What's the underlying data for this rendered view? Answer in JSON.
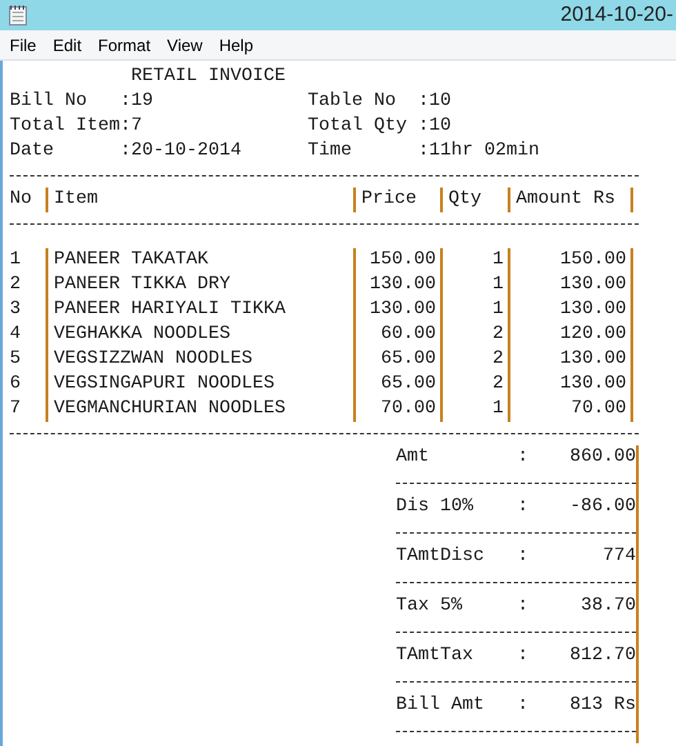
{
  "window": {
    "title": "2014-10-20-"
  },
  "menu": [
    "File",
    "Edit",
    "Format",
    "View",
    "Help"
  ],
  "invoice": {
    "heading": "RETAIL INVOICE",
    "fields": [
      [
        "Bill No   :19",
        "Table No  :10"
      ],
      [
        "Total Item:7",
        "Total Qty :10"
      ],
      [
        "Date      :20-10-2014",
        "Time      :11hr 02min"
      ]
    ],
    "columns": [
      "No",
      "Item",
      "Price",
      "Qty",
      "Amount Rs"
    ],
    "rows": [
      {
        "no": "1",
        "item": "PANEER TAKATAK",
        "price": "150.00",
        "qty": "1",
        "amount": "150.00"
      },
      {
        "no": "2",
        "item": "PANEER TIKKA DRY",
        "price": "130.00",
        "qty": "1",
        "amount": "130.00"
      },
      {
        "no": "3",
        "item": "PANEER HARIYALI TIKKA",
        "price": "130.00",
        "qty": "1",
        "amount": "130.00"
      },
      {
        "no": "4",
        "item": "VEGHAKKA NOODLES",
        "price": "60.00",
        "qty": "2",
        "amount": "120.00"
      },
      {
        "no": "5",
        "item": "VEGSIZZWAN NOODLES",
        "price": "65.00",
        "qty": "2",
        "amount": "130.00"
      },
      {
        "no": "6",
        "item": "VEGSINGAPURI NOODLES",
        "price": "65.00",
        "qty": "2",
        "amount": "130.00"
      },
      {
        "no": "7",
        "item": "VEGMANCHURIAN NOODLES",
        "price": "70.00",
        "qty": "1",
        "amount": "70.00"
      }
    ],
    "summary": [
      {
        "label": "Amt",
        "separator": ":",
        "value": "860.00"
      },
      {
        "label": "Dis 10%",
        "separator": ":",
        "value": "-86.00"
      },
      {
        "label": "TAmtDisc",
        "separator": ":",
        "value": "774"
      },
      {
        "label": "Tax 5%",
        "separator": ":",
        "value": "38.70"
      },
      {
        "label": "TAmtTax",
        "separator": ":",
        "value": "812.70"
      },
      {
        "label": "Bill Amt",
        "separator": ":",
        "value": "813 Rs"
      }
    ]
  }
}
